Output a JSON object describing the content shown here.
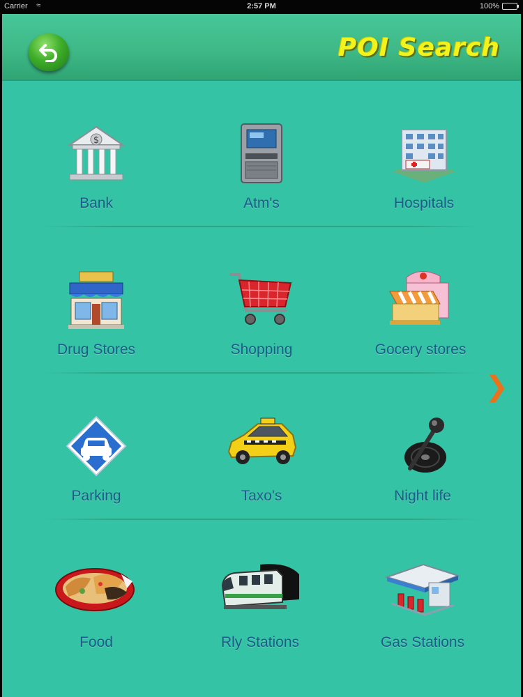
{
  "status_bar": {
    "carrier": "Carrier",
    "time": "2:57 PM",
    "battery": "100%",
    "battery_level": 1.0
  },
  "nav": {
    "title": "POI Search",
    "back_icon": "back-arrow-icon"
  },
  "accent_colors": {
    "background": "#35c3a5",
    "title": "#f2f21c",
    "label": "#1d5c8a",
    "chevron": "#e9731c"
  },
  "categories": [
    {
      "label": "Bank",
      "icon": "bank-icon"
    },
    {
      "label": "Atm's",
      "icon": "atm-icon"
    },
    {
      "label": "Hospitals",
      "icon": "hospital-icon"
    },
    {
      "label": "Drug Stores",
      "icon": "drug-store-icon"
    },
    {
      "label": "Shopping",
      "icon": "shopping-cart-icon"
    },
    {
      "label": "Gocery stores",
      "icon": "grocery-store-icon"
    },
    {
      "label": "Parking",
      "icon": "parking-sign-icon"
    },
    {
      "label": "Taxo's",
      "icon": "taxi-icon"
    },
    {
      "label": "Night life",
      "icon": "microphone-record-icon"
    },
    {
      "label": "Food",
      "icon": "food-plate-icon"
    },
    {
      "label": "Rly Stations",
      "icon": "train-icon"
    },
    {
      "label": "Gas Stations",
      "icon": "gas-station-icon"
    }
  ],
  "next_page_icon": "chevron-right-icon"
}
